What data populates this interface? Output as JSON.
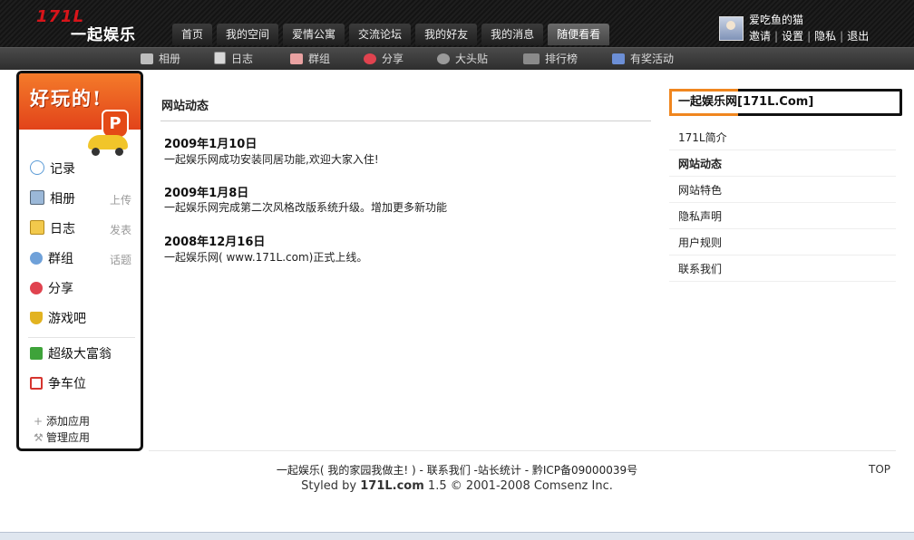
{
  "header": {
    "logo_number": "171L",
    "logo_text": "一起娱乐",
    "nav": [
      {
        "label": "首页"
      },
      {
        "label": "我的空间"
      },
      {
        "label": "爱情公寓"
      },
      {
        "label": "交流论坛"
      },
      {
        "label": "我的好友"
      },
      {
        "label": "我的消息"
      },
      {
        "label": "随便看看",
        "active": true
      }
    ],
    "user": {
      "name": "爱吃鱼的猫",
      "links": [
        "邀请",
        "设置",
        "隐私",
        "退出"
      ]
    }
  },
  "subnav": [
    {
      "label": "相册",
      "icon": "camera-icon"
    },
    {
      "label": "日志",
      "icon": "document-icon"
    },
    {
      "label": "群组",
      "icon": "group-icon"
    },
    {
      "label": "分享",
      "icon": "heart-share-icon"
    },
    {
      "label": "大头贴",
      "icon": "photo-booth-icon"
    },
    {
      "label": "排行榜",
      "icon": "pk-icon"
    },
    {
      "label": "有奖活动",
      "icon": "gift-icon"
    }
  ],
  "sidebar": {
    "banner_title": "好玩的!",
    "banner_badge": "P",
    "apps": [
      {
        "label": "记录",
        "icon": "chat-bubble-icon"
      },
      {
        "label": "相册",
        "icon": "photo-icon",
        "action": "上传"
      },
      {
        "label": "日志",
        "icon": "notebook-icon",
        "action": "发表"
      },
      {
        "label": "群组",
        "icon": "people-icon",
        "action": "话题"
      },
      {
        "label": "分享",
        "icon": "hearts-icon"
      },
      {
        "label": "游戏吧",
        "icon": "trophy-icon"
      },
      {
        "label": "超级大富翁",
        "icon": "money-icon"
      },
      {
        "label": "争车位",
        "icon": "parking-icon"
      }
    ],
    "add_app": "添加应用",
    "manage_app": "管理应用"
  },
  "main": {
    "title": "网站动态",
    "news": [
      {
        "date": "2009年1月10日",
        "text": "一起娱乐网成功安装同居功能,欢迎大家入住!"
      },
      {
        "date": "2009年1月8日",
        "text": "一起娱乐网完成第二次风格改版系统升级。增加更多新功能"
      },
      {
        "date": "2008年12月16日",
        "text": "一起娱乐网( www.171L.com)正式上线。"
      }
    ]
  },
  "right": {
    "header": "一起娱乐网[171L.Com]",
    "links": [
      {
        "label": "171L简介"
      },
      {
        "label": "网站动态",
        "current": true
      },
      {
        "label": "网站特色"
      },
      {
        "label": "隐私声明"
      },
      {
        "label": "用户规则"
      },
      {
        "label": "联系我们"
      }
    ]
  },
  "footer": {
    "site_name": "一起娱乐( 我的家园我做主! )",
    "contact": "联系我们",
    "stats": "站长统计",
    "icp": "黔ICP备09000039号",
    "styled_prefix": "Styled by",
    "styled_brand": "171L.com",
    "styled_suffix": "1.5 © 2001-2008 Comsenz Inc.",
    "top": "TOP"
  }
}
